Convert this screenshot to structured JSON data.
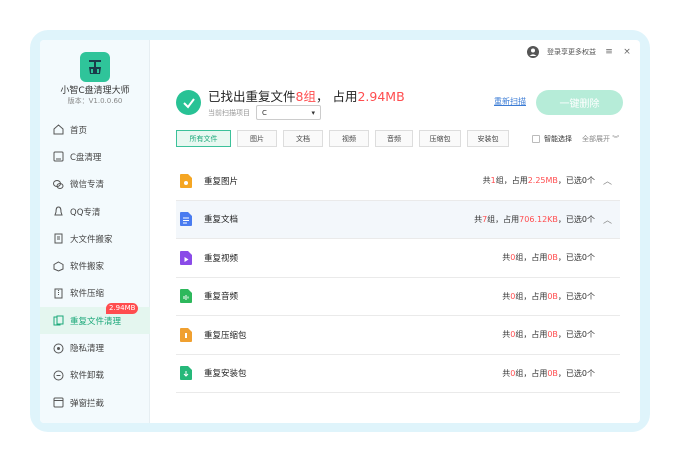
{
  "app": {
    "name": "小智C盘清理大师",
    "version": "版本：V1.0.0.60"
  },
  "topbar": {
    "login_text": "登录享更多权益",
    "menu_icon": "≡",
    "close_icon": "×"
  },
  "sidebar": {
    "items": [
      {
        "label": "首页",
        "icon": "home-icon"
      },
      {
        "label": "C盘清理",
        "icon": "broom-icon"
      },
      {
        "label": "微信专清",
        "icon": "wechat-icon"
      },
      {
        "label": "QQ专清",
        "icon": "qq-icon"
      },
      {
        "label": "大文件搬家",
        "icon": "file-move-icon"
      },
      {
        "label": "软件搬家",
        "icon": "box-icon"
      },
      {
        "label": "软件压缩",
        "icon": "compress-icon"
      },
      {
        "label": "重复文件清理",
        "icon": "duplicate-file-icon",
        "active": true,
        "badge": "2.94MB"
      },
      {
        "label": "隐私清理",
        "icon": "privacy-icon"
      },
      {
        "label": "软件卸载",
        "icon": "uninstall-icon"
      },
      {
        "label": "弹窗拦截",
        "icon": "popup-block-icon"
      }
    ]
  },
  "summary": {
    "prefix": "已找出重复文件",
    "groups": "8组",
    "occupy_label": "占用",
    "size": "2.94MB",
    "scan_label": "当前扫描项目",
    "scan_value": "C",
    "rescan": "重新扫描",
    "delete_button": "一键删除"
  },
  "tabs": [
    "所有文件",
    "图片",
    "文档",
    "视频",
    "音频",
    "压缩包",
    "安装包"
  ],
  "smart_select": "智能选择",
  "expand_all": "全部展开",
  "rows": [
    {
      "name": "重复图片",
      "pre": "共",
      "groups": "1",
      "mid": "组，占用",
      "size": "2.25MB",
      "post": "，已选0个",
      "arrow": true,
      "color": "#f5a623"
    },
    {
      "name": "重复文档",
      "pre": "共",
      "groups": "7",
      "mid": "组，占用",
      "size": "706.12KB",
      "post": "，已选0个",
      "arrow": true,
      "color": "#4a7cf0",
      "highlight": true
    },
    {
      "name": "重复视频",
      "pre": "共",
      "groups": "0",
      "mid": "组，占用",
      "size": "0B",
      "post": "，已选0个",
      "arrow": false,
      "color": "#8a4be8"
    },
    {
      "name": "重复音频",
      "pre": "共",
      "groups": "0",
      "mid": "组，占用",
      "size": "0B",
      "post": "，已选0个",
      "arrow": false,
      "color": "#2db85c"
    },
    {
      "name": "重复压缩包",
      "pre": "共",
      "groups": "0",
      "mid": "组，占用",
      "size": "0B",
      "post": "，已选0个",
      "arrow": false,
      "color": "#f0a030"
    },
    {
      "name": "重复安装包",
      "pre": "共",
      "groups": "0",
      "mid": "组，占用",
      "size": "0B",
      "post": "，已选0个",
      "arrow": false,
      "color": "#26b87a"
    }
  ]
}
